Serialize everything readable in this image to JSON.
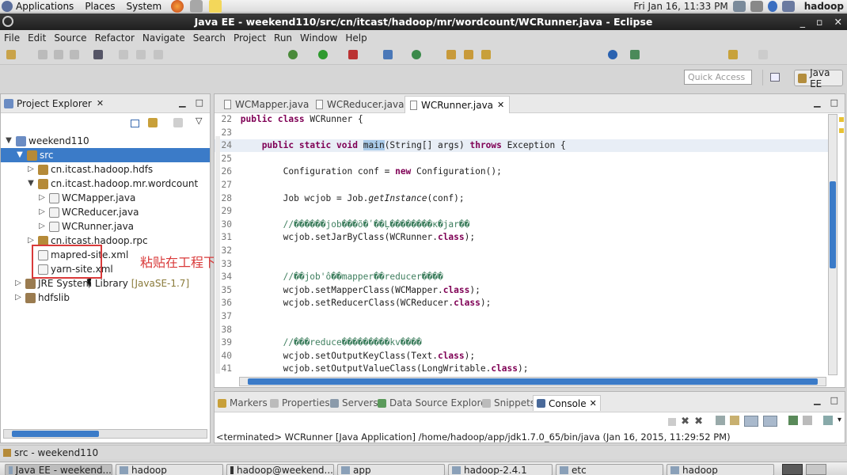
{
  "top_panel": {
    "menus": [
      "Applications",
      "Places",
      "System"
    ],
    "clock": "Fri Jan 16, 11:33 PM",
    "user": "hadoop"
  },
  "window": {
    "title": "Java EE - weekend110/src/cn/itcast/hadoop/mr/wordcount/WCRunner.java - Eclipse"
  },
  "menubar": [
    "File",
    "Edit",
    "Source",
    "Refactor",
    "Navigate",
    "Search",
    "Project",
    "Run",
    "Window",
    "Help"
  ],
  "toolbar": {
    "quick_access_placeholder": "Quick Access",
    "perspective_label": "Java EE"
  },
  "explorer": {
    "title": "Project Explorer",
    "tree": [
      {
        "label": "weekend110",
        "icon": "project-icon",
        "depth": 0,
        "expanded": true
      },
      {
        "label": "src",
        "icon": "package-folder-icon",
        "depth": 1,
        "expanded": true,
        "selected": true
      },
      {
        "label": "cn.itcast.hadoop.hdfs",
        "icon": "package-icon",
        "depth": 2,
        "expanded": false
      },
      {
        "label": "cn.itcast.hadoop.mr.wordcount",
        "icon": "package-icon",
        "depth": 2,
        "expanded": true
      },
      {
        "label": "WCMapper.java",
        "icon": "java-file-icon",
        "depth": 3,
        "expanded": false
      },
      {
        "label": "WCReducer.java",
        "icon": "java-file-icon",
        "depth": 3,
        "expanded": false
      },
      {
        "label": "WCRunner.java",
        "icon": "java-file-icon",
        "depth": 3,
        "expanded": false
      },
      {
        "label": "cn.itcast.hadoop.rpc",
        "icon": "package-icon",
        "depth": 2,
        "expanded": false
      },
      {
        "label": "mapred-site.xml",
        "icon": "xml-file-icon",
        "depth": 2
      },
      {
        "label": "yarn-site.xml",
        "icon": "xml-file-icon",
        "depth": 2
      },
      {
        "label": "JRE System Library",
        "suffix": "[JavaSE-1.7]",
        "icon": "library-icon",
        "depth": 1,
        "expanded": false
      },
      {
        "label": "hdfslib",
        "icon": "library-icon",
        "depth": 1,
        "expanded": false
      }
    ],
    "annotation": "粘贴在工程下"
  },
  "editor": {
    "tabs": [
      {
        "label": "WCMapper.java",
        "active": false
      },
      {
        "label": "WCReducer.java",
        "active": false
      },
      {
        "label": "WCRunner.java",
        "active": true
      }
    ],
    "lines": [
      {
        "n": "22",
        "html": "<span class=\"kw\">public</span> <span class=\"kw\">class</span> WCRunner {"
      },
      {
        "n": "23",
        "html": ""
      },
      {
        "n": "24",
        "html": "    <span class=\"kw\">public</span> <span class=\"kw\">static</span> <span class=\"kw\">void</span> <span class=\"hlword\">main</span>(String[] args) <span class=\"kw\">throws</span> Exception {",
        "hl": true
      },
      {
        "n": "25",
        "html": ""
      },
      {
        "n": "26",
        "html": "        Configuration conf = <span class=\"kw\">new</span> Configuration();"
      },
      {
        "n": "27",
        "html": ""
      },
      {
        "n": "28",
        "html": "        Job wcjob = Job.<span class=\"it\">getInstance</span>(conf);"
      },
      {
        "n": "29",
        "html": ""
      },
      {
        "n": "30",
        "html": "        <span class=\"cmt\">//������job���õ�ʹ��Ļ��������κ�jar��</span>"
      },
      {
        "n": "31",
        "html": "        wcjob.setJarByClass(WCRunner.<span class=\"kw\">class</span>);"
      },
      {
        "n": "32",
        "html": ""
      },
      {
        "n": "33",
        "html": ""
      },
      {
        "n": "34",
        "html": "        <span class=\"cmt\">//��job'ô��mapper��reducer����</span>"
      },
      {
        "n": "35",
        "html": "        wcjob.setMapperClass(WCMapper.<span class=\"kw\">class</span>);"
      },
      {
        "n": "36",
        "html": "        wcjob.setReducerClass(WCReducer.<span class=\"kw\">class</span>);"
      },
      {
        "n": "37",
        "html": ""
      },
      {
        "n": "38",
        "html": ""
      },
      {
        "n": "39",
        "html": "        <span class=\"cmt\">//���reduce���������kv����</span>"
      },
      {
        "n": "40",
        "html": "        wcjob.setOutputKeyClass(Text.<span class=\"kw\">class</span>);"
      },
      {
        "n": "41",
        "html": "        wcjob.setOutputValueClass(LongWritable.<span class=\"kw\">class</span>);"
      }
    ]
  },
  "bottom": {
    "tabs": [
      {
        "label": "Markers",
        "active": false
      },
      {
        "label": "Properties",
        "active": false
      },
      {
        "label": "Servers",
        "active": false
      },
      {
        "label": "Data Source Explorer",
        "active": false
      },
      {
        "label": "Snippets",
        "active": false
      },
      {
        "label": "Console",
        "active": true
      }
    ],
    "console_text": "<terminated> WCRunner [Java Application] /home/hadoop/app/jdk1.7.0_65/bin/java (Jan 16, 2015, 11:29:52 PM)"
  },
  "statusbar": {
    "text": "src - weekend110"
  },
  "taskbar": {
    "items": [
      {
        "label": "Java EE - weekend...",
        "active": true
      },
      {
        "label": "hadoop",
        "active": false
      },
      {
        "label": "hadoop@weekend...",
        "active": false
      },
      {
        "label": "app",
        "active": false
      },
      {
        "label": "hadoop-2.4.1",
        "active": false
      },
      {
        "label": "etc",
        "active": false
      },
      {
        "label": "hadoop",
        "active": false
      }
    ]
  },
  "colors": {
    "selection": "#3b7bc8",
    "annotation_red": "#d93a3a",
    "keyword": "#7f0055",
    "comment": "#3f7f5f"
  }
}
